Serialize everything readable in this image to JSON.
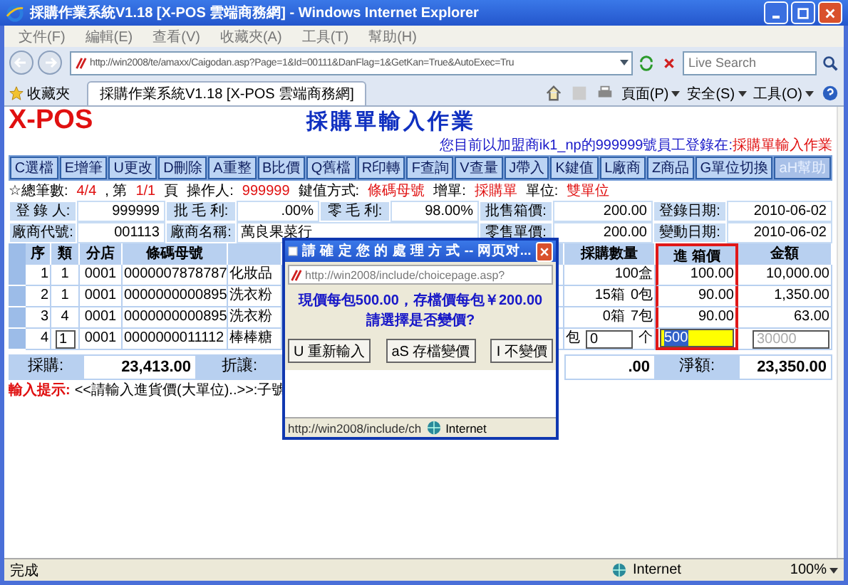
{
  "window": {
    "title": "採購作業系統V1.18 [X-POS 雲端商務網] - Windows Internet Explorer"
  },
  "menu": [
    "文件(F)",
    "編輯(E)",
    "查看(V)",
    "收藏夾(A)",
    "工具(T)",
    "幫助(H)"
  ],
  "address": {
    "url": "http://win2008/te/amaxx/Caigodan.asp?Page=1&Id=00111&DanFlag=1&GetKan=True&AutoExec=Tru"
  },
  "search": {
    "placeholder": "Live Search"
  },
  "favorites": {
    "label": "收藏夾"
  },
  "tabs": [
    {
      "label": "採購作業系統V1.18 [X-POS 雲端商務網]",
      "selected": true
    }
  ],
  "command_bar": [
    "頁面(P)",
    "安全(S)",
    "工具(O)"
  ],
  "page": {
    "logo": "X-POS",
    "title": "採購單輸入作業",
    "login_info": "您目前以加盟商ik1_np的999999號員工登錄在:",
    "login_module": "採購單輸入作業"
  },
  "toolbar": [
    {
      "label": "C選檔",
      "disabled": false
    },
    {
      "label": "E增筆",
      "disabled": false
    },
    {
      "label": "U更改",
      "disabled": false
    },
    {
      "label": "D刪除",
      "disabled": false
    },
    {
      "label": "A重整",
      "disabled": false
    },
    {
      "label": "B比價",
      "disabled": false
    },
    {
      "label": "Q舊檔",
      "disabled": false
    },
    {
      "label": "R印轉",
      "disabled": false
    },
    {
      "label": "F查詢",
      "disabled": false
    },
    {
      "label": "V查量",
      "disabled": false
    },
    {
      "label": "J帶入",
      "disabled": false
    },
    {
      "label": "K鍵值",
      "disabled": false
    },
    {
      "label": "L廠商",
      "disabled": false
    },
    {
      "label": "Z商品",
      "disabled": false
    },
    {
      "label": "G單位切換",
      "disabled": false
    },
    {
      "label": "aH幫助",
      "disabled": true
    }
  ],
  "status_line": [
    {
      "text": "☆總筆數:",
      "highlight": false
    },
    {
      "text": "4/4",
      "highlight": true
    },
    {
      "text": ", 第",
      "highlight": false
    },
    {
      "text": "1/1",
      "highlight": true
    },
    {
      "text": "頁",
      "highlight": false
    },
    {
      "text": "操作人:",
      "highlight": false
    },
    {
      "text": "999999",
      "highlight": true
    },
    {
      "text": "鍵值方式:",
      "highlight": false
    },
    {
      "text": "條碼母號",
      "highlight": true
    },
    {
      "text": "增單:",
      "highlight": false
    },
    {
      "text": "採購單",
      "highlight": true
    },
    {
      "text": "單位:",
      "highlight": false
    },
    {
      "text": "雙單位",
      "highlight": true
    }
  ],
  "form": [
    [
      {
        "label": "登 錄 人:",
        "value": "999999",
        "kind": "normal"
      },
      {
        "label": "批 毛 利:",
        "value": ".00%",
        "kind": "normal"
      },
      {
        "label": "零 毛 利:",
        "value": "98.00%",
        "kind": "normal"
      },
      {
        "label": "批售箱價:",
        "value": "200.00",
        "kind": "normal"
      },
      {
        "label": "登錄日期:",
        "value": "2010-06-02",
        "kind": "normal"
      }
    ],
    [
      {
        "label": "廠商代號:",
        "value": "001113",
        "kind": "normal"
      },
      {
        "label": "廠商名稱:",
        "value": "萬良果菜行",
        "kind": "wide"
      },
      {
        "label": "零售單價:",
        "value": "200.00",
        "kind": "normal"
      },
      {
        "label": "變動日期:",
        "value": "2010-06-02",
        "kind": "normal"
      }
    ]
  ],
  "table": {
    "columns": [
      {
        "label": "序",
        "highlighted": false
      },
      {
        "label": "類",
        "highlighted": false
      },
      {
        "label": "分店",
        "highlighted": false
      },
      {
        "label": "條碼母號",
        "highlighted": false
      },
      {
        "label": "採購數量",
        "highlighted": false
      },
      {
        "label": "進 箱價",
        "highlighted": true
      },
      {
        "label": "金額",
        "highlighted": false
      }
    ],
    "rows": [
      {
        "seq": "1",
        "type": {
          "kind": "text",
          "text": "1"
        },
        "store": "0001",
        "barcode": "0000007878787",
        "name": "化妝品",
        "qty": {
          "kind": "text",
          "parts": [
            "100盒"
          ]
        },
        "price": {
          "kind": "text",
          "text": "100.00"
        },
        "amount": {
          "kind": "text",
          "text": "10,000.00"
        }
      },
      {
        "seq": "2",
        "type": {
          "kind": "text",
          "text": "1"
        },
        "store": "0001",
        "barcode": "0000000000895",
        "name": "洗衣粉",
        "qty": {
          "kind": "text",
          "parts": [
            "15箱",
            "0包"
          ]
        },
        "price": {
          "kind": "text",
          "text": "90.00"
        },
        "amount": {
          "kind": "text",
          "text": "1,350.00"
        }
      },
      {
        "seq": "3",
        "type": {
          "kind": "text",
          "text": "4"
        },
        "store": "0001",
        "barcode": "0000000000895",
        "name": "洗衣粉",
        "qty": {
          "kind": "text",
          "parts": [
            "0箱",
            "7包"
          ]
        },
        "price": {
          "kind": "text",
          "text": "90.00"
        },
        "amount": {
          "kind": "text",
          "text": "63.00"
        }
      },
      {
        "seq": "4",
        "type": {
          "kind": "input",
          "text": "1"
        },
        "store": "0001",
        "barcode": "0000000011112",
        "name": "棒棒糖",
        "qty": {
          "kind": "input",
          "prefix": "包",
          "text": "0",
          "suffix": "个"
        },
        "price": {
          "kind": "input",
          "text": "500",
          "focused": true
        },
        "amount": {
          "kind": "input",
          "text": "30000",
          "disabled": true
        }
      }
    ]
  },
  "totals": [
    {
      "label": "採購:",
      "value": "23,413.00"
    },
    {
      "label": "折讓:",
      "value": ".00"
    },
    {
      "label": "淨額:",
      "value": "23,350.00"
    }
  ],
  "hint": {
    "label": "輸入提示:",
    "text": "<<請輸入進貨價(大單位)..>>:子號"
  },
  "dialog": {
    "title": "請 確 定 您 的 處 理 方 式 -- 网页对...",
    "url": "http://win2008/include/choicepage.asp?",
    "message": [
      "現價每包500.00，存檔價每包￥200.00",
      "請選擇是否變價?"
    ],
    "buttons": [
      "U 重新輸入",
      "aS 存檔變價",
      "I 不變價"
    ],
    "status_url": "http://win2008/include/ch",
    "status_zone": "Internet"
  },
  "status_bar": {
    "text": "完成",
    "zone": "Internet",
    "zoom": "100%"
  }
}
